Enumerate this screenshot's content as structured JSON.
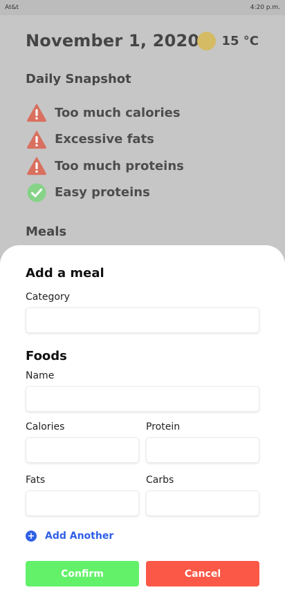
{
  "status_bar": {
    "carrier": "At&t",
    "time": "4:20 p.m."
  },
  "header": {
    "date": "November 1, 2020",
    "weather_icon": "sun-icon",
    "weather_color": "#d4bb64",
    "temperature": "15 °C"
  },
  "snapshot": {
    "title": "Daily Snapshot",
    "items": [
      {
        "label": "Too much calories",
        "status": "warning",
        "icon": "warning-icon",
        "color": "#d9705f"
      },
      {
        "label": "Excessive fats",
        "status": "warning",
        "icon": "warning-icon",
        "color": "#d9705f"
      },
      {
        "label": "Too much proteins",
        "status": "warning",
        "icon": "warning-icon",
        "color": "#d9705f"
      },
      {
        "label": "Easy proteins",
        "status": "ok",
        "icon": "check-circle-icon",
        "color": "#86d388"
      }
    ]
  },
  "meals": {
    "title": "Meals"
  },
  "sheet": {
    "title": "Add a meal",
    "category_label": "Category",
    "category_value": "",
    "foods_title": "Foods",
    "name_label": "Name",
    "name_value": "",
    "calories_label": "Calories",
    "calories_value": "",
    "protein_label": "Protein",
    "protein_value": "",
    "fats_label": "Fats",
    "fats_value": "",
    "carbs_label": "Carbs",
    "carbs_value": "",
    "add_another_label": "Add Another",
    "add_another_icon": "plus-circle-icon",
    "confirm_label": "Confirm",
    "cancel_label": "Cancel",
    "colors": {
      "accent": "#2f5fe6",
      "confirm": "#63f16a",
      "cancel": "#fb5847"
    }
  }
}
